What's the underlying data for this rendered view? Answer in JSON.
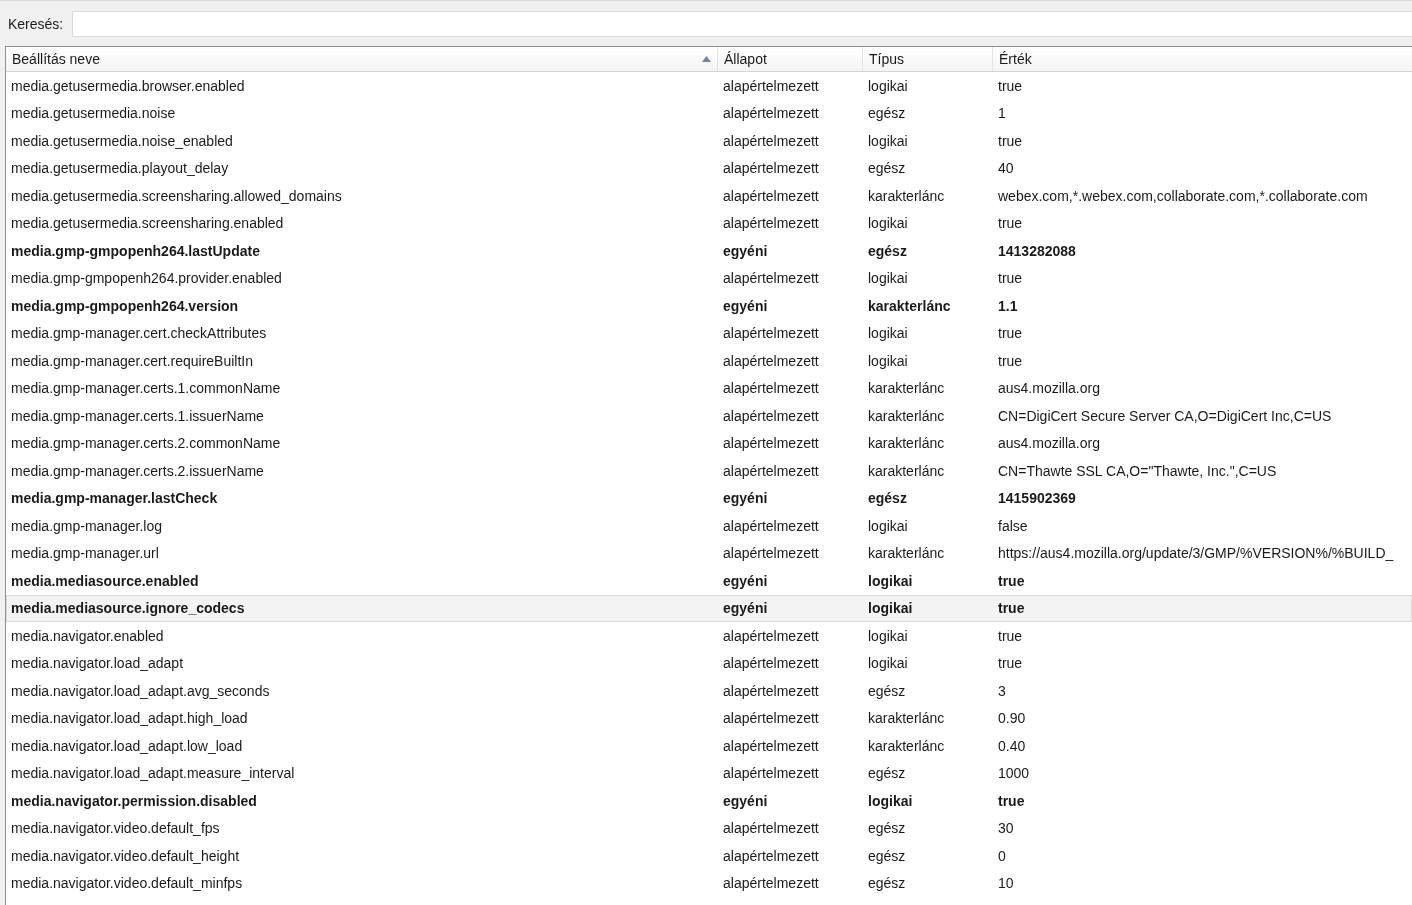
{
  "search": {
    "label": "Keresés:"
  },
  "table": {
    "columns": [
      {
        "label": "Beállítás neve",
        "sorted": true
      },
      {
        "label": "Állapot",
        "sorted": false
      },
      {
        "label": "Típus",
        "sorted": false
      },
      {
        "label": "Érték",
        "sorted": false
      }
    ],
    "rows": [
      {
        "name": "media.getusermedia.browser.enabled",
        "state": "alapértelmezett",
        "type": "logikai",
        "value": "true",
        "modified": false,
        "selected": false
      },
      {
        "name": "media.getusermedia.noise",
        "state": "alapértelmezett",
        "type": "egész",
        "value": "1",
        "modified": false,
        "selected": false
      },
      {
        "name": "media.getusermedia.noise_enabled",
        "state": "alapértelmezett",
        "type": "logikai",
        "value": "true",
        "modified": false,
        "selected": false
      },
      {
        "name": "media.getusermedia.playout_delay",
        "state": "alapértelmezett",
        "type": "egész",
        "value": "40",
        "modified": false,
        "selected": false
      },
      {
        "name": "media.getusermedia.screensharing.allowed_domains",
        "state": "alapértelmezett",
        "type": "karakterlánc",
        "value": "webex.com,*.webex.com,collaborate.com,*.collaborate.com",
        "modified": false,
        "selected": false
      },
      {
        "name": "media.getusermedia.screensharing.enabled",
        "state": "alapértelmezett",
        "type": "logikai",
        "value": "true",
        "modified": false,
        "selected": false
      },
      {
        "name": "media.gmp-gmpopenh264.lastUpdate",
        "state": "egyéni",
        "type": "egész",
        "value": "1413282088",
        "modified": true,
        "selected": false
      },
      {
        "name": "media.gmp-gmpopenh264.provider.enabled",
        "state": "alapértelmezett",
        "type": "logikai",
        "value": "true",
        "modified": false,
        "selected": false
      },
      {
        "name": "media.gmp-gmpopenh264.version",
        "state": "egyéni",
        "type": "karakterlánc",
        "value": "1.1",
        "modified": true,
        "selected": false
      },
      {
        "name": "media.gmp-manager.cert.checkAttributes",
        "state": "alapértelmezett",
        "type": "logikai",
        "value": "true",
        "modified": false,
        "selected": false
      },
      {
        "name": "media.gmp-manager.cert.requireBuiltIn",
        "state": "alapértelmezett",
        "type": "logikai",
        "value": "true",
        "modified": false,
        "selected": false
      },
      {
        "name": "media.gmp-manager.certs.1.commonName",
        "state": "alapértelmezett",
        "type": "karakterlánc",
        "value": "aus4.mozilla.org",
        "modified": false,
        "selected": false
      },
      {
        "name": "media.gmp-manager.certs.1.issuerName",
        "state": "alapértelmezett",
        "type": "karakterlánc",
        "value": "CN=DigiCert Secure Server CA,O=DigiCert Inc,C=US",
        "modified": false,
        "selected": false
      },
      {
        "name": "media.gmp-manager.certs.2.commonName",
        "state": "alapértelmezett",
        "type": "karakterlánc",
        "value": "aus4.mozilla.org",
        "modified": false,
        "selected": false
      },
      {
        "name": "media.gmp-manager.certs.2.issuerName",
        "state": "alapértelmezett",
        "type": "karakterlánc",
        "value": "CN=Thawte SSL CA,O=\"Thawte, Inc.\",C=US",
        "modified": false,
        "selected": false
      },
      {
        "name": "media.gmp-manager.lastCheck",
        "state": "egyéni",
        "type": "egész",
        "value": "1415902369",
        "modified": true,
        "selected": false
      },
      {
        "name": "media.gmp-manager.log",
        "state": "alapértelmezett",
        "type": "logikai",
        "value": "false",
        "modified": false,
        "selected": false
      },
      {
        "name": "media.gmp-manager.url",
        "state": "alapértelmezett",
        "type": "karakterlánc",
        "value": "https://aus4.mozilla.org/update/3/GMP/%VERSION%/%BUILD_",
        "modified": false,
        "selected": false
      },
      {
        "name": "media.mediasource.enabled",
        "state": "egyéni",
        "type": "logikai",
        "value": "true",
        "modified": true,
        "selected": false
      },
      {
        "name": "media.mediasource.ignore_codecs",
        "state": "egyéni",
        "type": "logikai",
        "value": "true",
        "modified": true,
        "selected": true
      },
      {
        "name": "media.navigator.enabled",
        "state": "alapértelmezett",
        "type": "logikai",
        "value": "true",
        "modified": false,
        "selected": false
      },
      {
        "name": "media.navigator.load_adapt",
        "state": "alapértelmezett",
        "type": "logikai",
        "value": "true",
        "modified": false,
        "selected": false
      },
      {
        "name": "media.navigator.load_adapt.avg_seconds",
        "state": "alapértelmezett",
        "type": "egész",
        "value": "3",
        "modified": false,
        "selected": false
      },
      {
        "name": "media.navigator.load_adapt.high_load",
        "state": "alapértelmezett",
        "type": "karakterlánc",
        "value": "0.90",
        "modified": false,
        "selected": false
      },
      {
        "name": "media.navigator.load_adapt.low_load",
        "state": "alapértelmezett",
        "type": "karakterlánc",
        "value": "0.40",
        "modified": false,
        "selected": false
      },
      {
        "name": "media.navigator.load_adapt.measure_interval",
        "state": "alapértelmezett",
        "type": "egész",
        "value": "1000",
        "modified": false,
        "selected": false
      },
      {
        "name": "media.navigator.permission.disabled",
        "state": "egyéni",
        "type": "logikai",
        "value": "true",
        "modified": true,
        "selected": false
      },
      {
        "name": "media.navigator.video.default_fps",
        "state": "alapértelmezett",
        "type": "egész",
        "value": "30",
        "modified": false,
        "selected": false
      },
      {
        "name": "media.navigator.video.default_height",
        "state": "alapértelmezett",
        "type": "egész",
        "value": "0",
        "modified": false,
        "selected": false
      },
      {
        "name": "media.navigator.video.default_minfps",
        "state": "alapértelmezett",
        "type": "egész",
        "value": "10",
        "modified": false,
        "selected": false
      }
    ]
  }
}
